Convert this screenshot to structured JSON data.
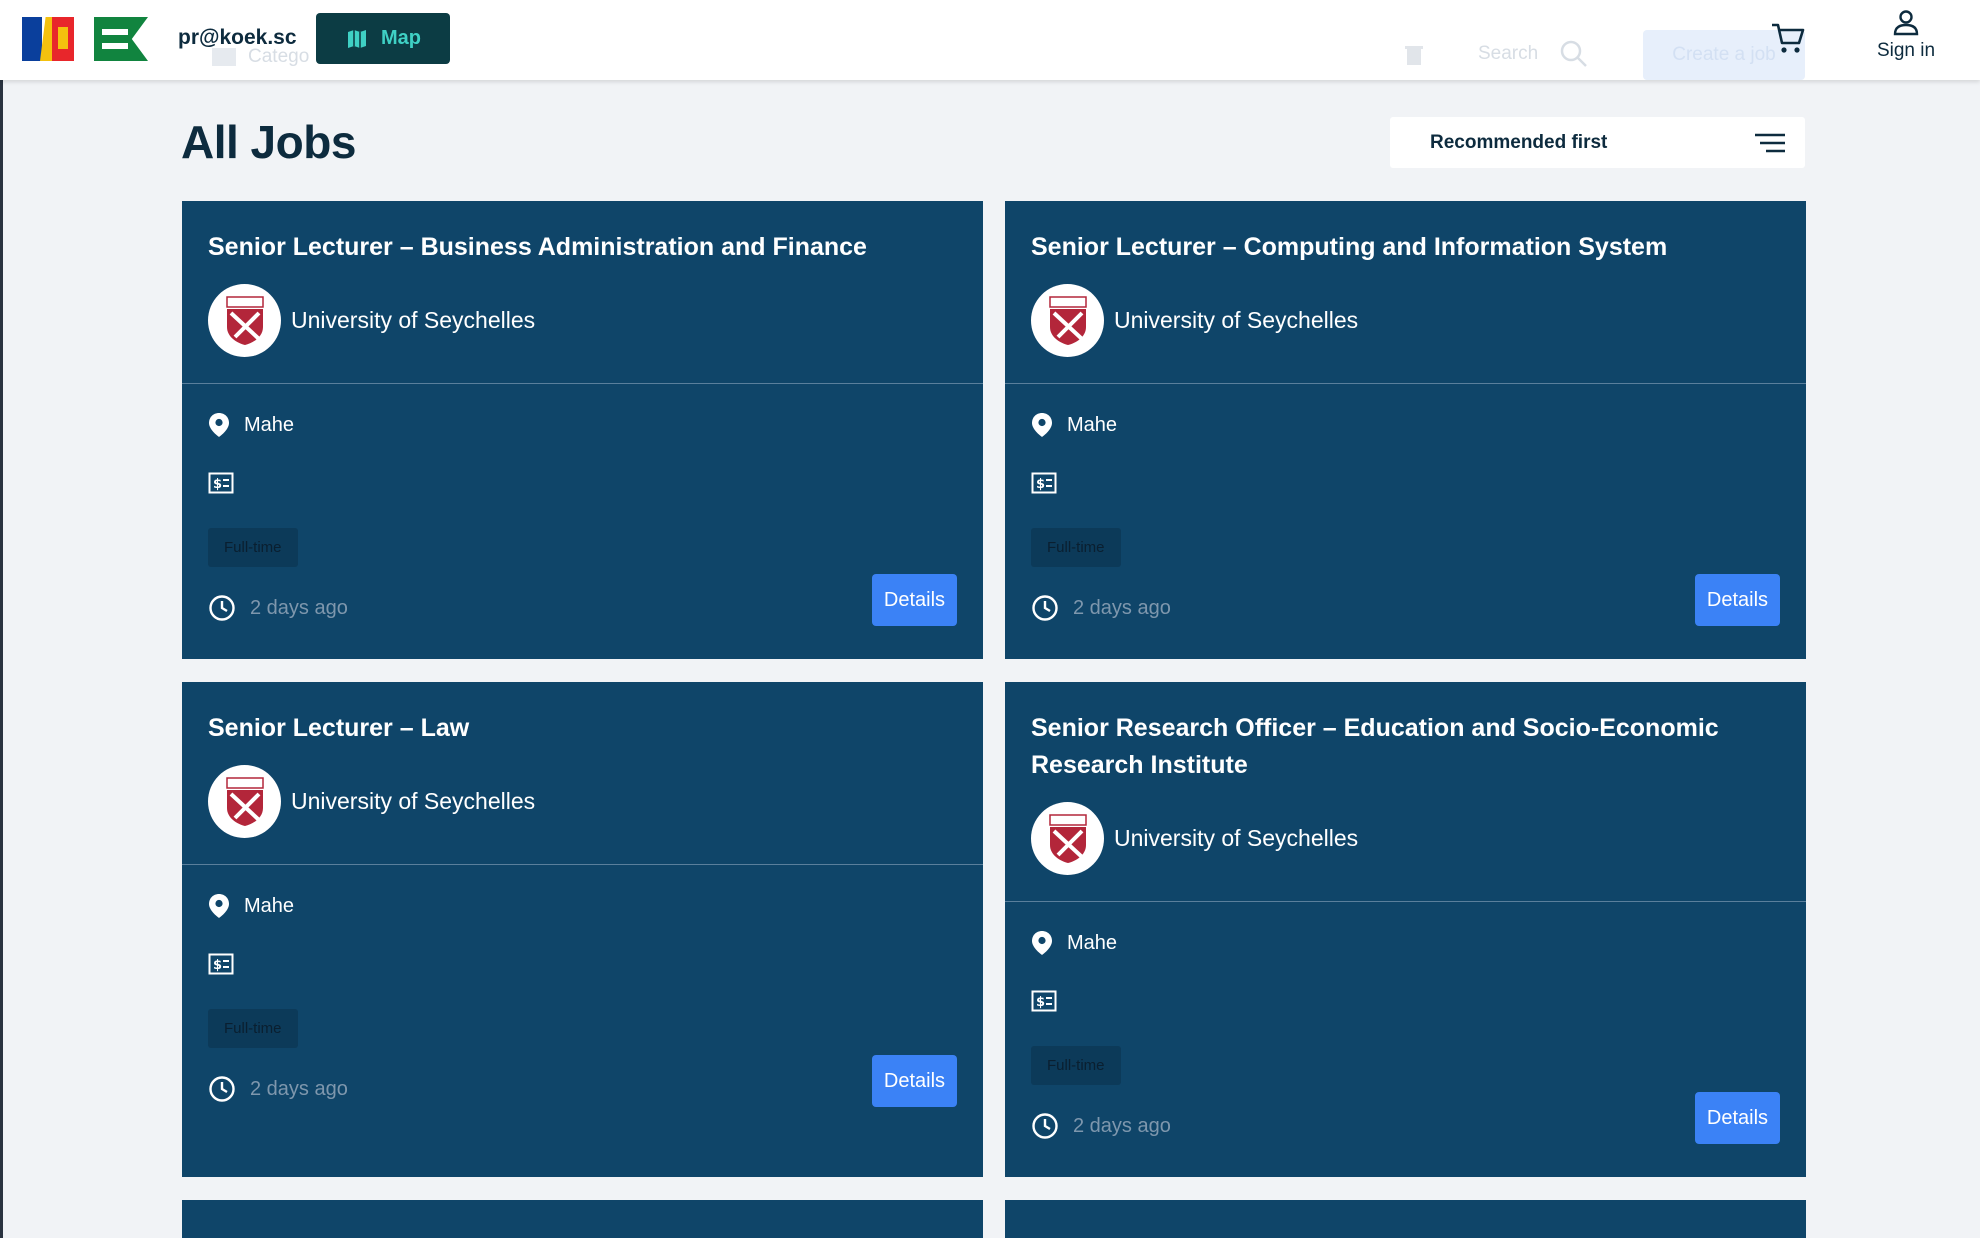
{
  "header": {
    "email": "pr@koek.sc",
    "map_label": "Map",
    "faded_category": "Catego",
    "faded_search": "Search",
    "faded_create": "Create a job",
    "signin_label": "Sign in"
  },
  "page": {
    "title": "All Jobs",
    "sort_label": "Recommended first"
  },
  "jobs": [
    {
      "title": "Senior Lecturer – Business Administration and Finance",
      "org": "University of Seychelles",
      "location": "Mahe",
      "type": "Full-time",
      "posted": "2 days ago",
      "details_label": "Details"
    },
    {
      "title": "Senior Lecturer – Computing and Information System",
      "org": "University of Seychelles",
      "location": "Mahe",
      "type": "Full-time",
      "posted": "2 days ago",
      "details_label": "Details"
    },
    {
      "title": "Senior Lecturer – Law",
      "org": "University of Seychelles",
      "location": "Mahe",
      "type": "Full-time",
      "posted": "2 days ago",
      "details_label": "Details"
    },
    {
      "title": "Senior Research Officer – Education and Socio-Economic Research Institute",
      "org": "University of Seychelles",
      "location": "Mahe",
      "type": "Full-time",
      "posted": "2 days ago",
      "details_label": "Details"
    }
  ],
  "colors": {
    "card_bg": "#0f4569",
    "accent_button": "#3b82f6",
    "map_button_bg": "#0c3c44",
    "map_button_text": "#3fd0c4",
    "page_bg": "#f1f3f6"
  },
  "icons": {
    "map": "map-icon",
    "cart": "cart-icon",
    "user": "user-icon",
    "sort": "sort-lines-icon",
    "location": "location-pin-icon",
    "salary": "salary-icon",
    "time": "clock-icon"
  }
}
